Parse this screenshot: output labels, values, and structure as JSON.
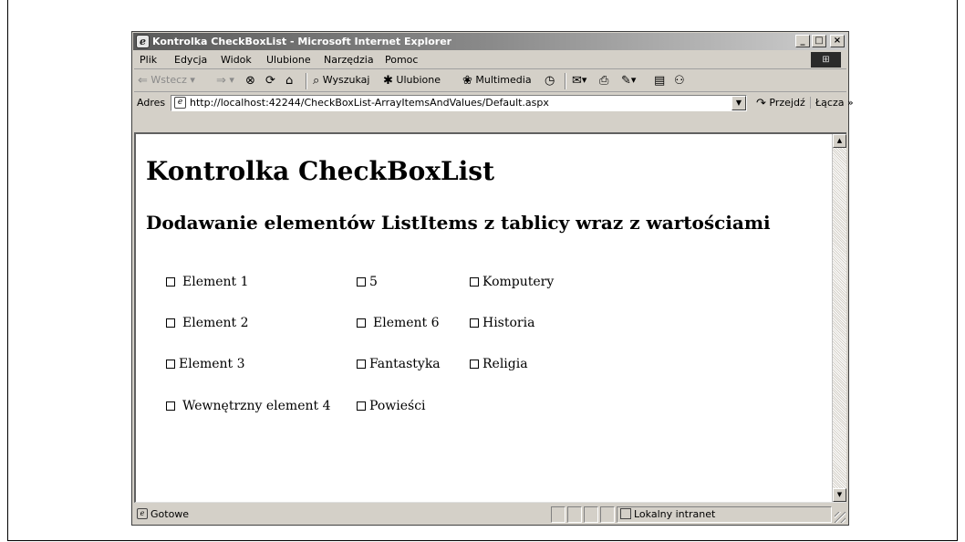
{
  "window": {
    "title": "Kontrolka CheckBoxList - Microsoft Internet Explorer",
    "controls": {
      "minimize": "_",
      "maximize": "□",
      "close": "×"
    }
  },
  "menubar": {
    "items": [
      {
        "label": "Plik"
      },
      {
        "label": "Edycja"
      },
      {
        "label": "Widok"
      },
      {
        "label": "Ulubione"
      },
      {
        "label": "Narzędzia"
      },
      {
        "label": "Pomoc"
      }
    ]
  },
  "toolbar": {
    "back": "Wstecz",
    "search": "Wyszukaj",
    "favorites": "Ulubione",
    "media": "Multimedia"
  },
  "address": {
    "label": "Adres",
    "url": "http://localhost:42244/CheckBoxList-ArrayItemsAndValues/Default.aspx",
    "go": "Przejdź",
    "links": "Łącza"
  },
  "page": {
    "heading": "Kontrolka CheckBoxList",
    "subheading": "Dodawanie elementów ListItems z tablicy wraz z wartościami",
    "checkboxes": [
      {
        "label": "Element 1",
        "checked": false
      },
      {
        "label": "5",
        "checked": false
      },
      {
        "label": "Komputery",
        "checked": false
      },
      {
        "label": "Element 2",
        "checked": false
      },
      {
        "label": "Element 6",
        "checked": false
      },
      {
        "label": "Historia",
        "checked": false
      },
      {
        "label": "Element 3",
        "checked": false
      },
      {
        "label": "Fantastyka",
        "checked": false
      },
      {
        "label": "Religia",
        "checked": false
      },
      {
        "label": "Wewnętrzny element 4",
        "checked": false
      },
      {
        "label": "Powieści",
        "checked": false
      }
    ]
  },
  "status": {
    "text": "Gotowe",
    "zone": "Lokalny intranet"
  }
}
